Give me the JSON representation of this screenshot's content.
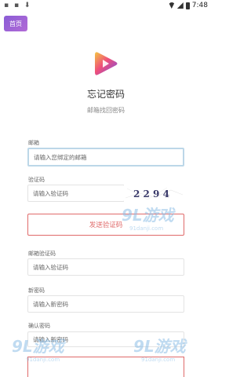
{
  "status_bar": {
    "left_icons": "▪ ▪ ⬇",
    "time": "7:48"
  },
  "nav": {
    "home_label": "首页"
  },
  "header": {
    "title": "忘记密码",
    "subtitle": "邮箱找回密码"
  },
  "form": {
    "email": {
      "label": "邮箱",
      "placeholder": "请输入您绑定的邮箱"
    },
    "captcha": {
      "label": "验证码",
      "placeholder": "请输入验证码",
      "image_text": "2 2 9 4"
    },
    "send_button": "发送验证码",
    "email_code": {
      "label": "邮箱验证码",
      "placeholder": "请输入验证码"
    },
    "new_password": {
      "label": "新密码",
      "placeholder": "请输入新密码"
    },
    "confirm_password": {
      "label": "确认密码",
      "placeholder": "请输入新密码"
    }
  },
  "watermarks": [
    {
      "logo": "9L游戏",
      "site": "91danji.com"
    },
    {
      "logo": "9L游戏",
      "site": "91danji.com"
    },
    {
      "logo": "9L游戏",
      "site": "91danji.com"
    }
  ],
  "colors": {
    "accent": "#e06a6a",
    "home_button": "#9b63d6",
    "focus_border": "#bcd7e8"
  }
}
